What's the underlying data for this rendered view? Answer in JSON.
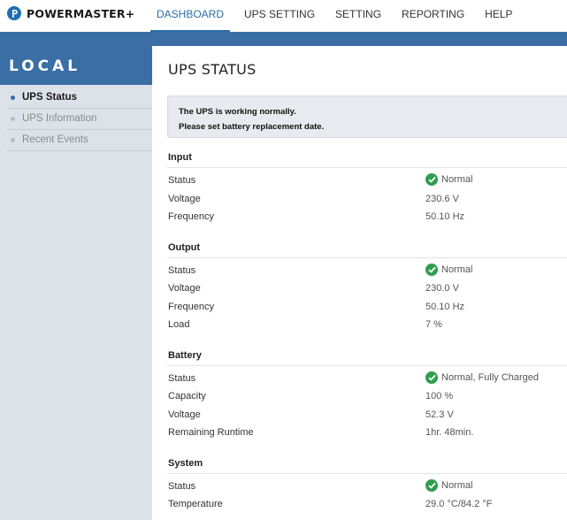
{
  "brand": {
    "name": "POWERMASTER",
    "plus": "+"
  },
  "nav": [
    {
      "label": "DASHBOARD"
    },
    {
      "label": "UPS SETTING"
    },
    {
      "label": "SETTING"
    },
    {
      "label": "REPORTING"
    },
    {
      "label": "HELP"
    }
  ],
  "sidebar": {
    "title": "LOCAL",
    "items": [
      {
        "label": "UPS Status"
      },
      {
        "label": "UPS Information"
      },
      {
        "label": "Recent Events"
      }
    ]
  },
  "main": {
    "title": "UPS STATUS",
    "notice": {
      "line1": "The UPS is working normally.",
      "line2": "Please set battery replacement date."
    },
    "sections": {
      "input": {
        "title": "Input",
        "rows": [
          {
            "label": "Status",
            "value": "Normal"
          },
          {
            "label": "Voltage",
            "value": "230.6 V"
          },
          {
            "label": "Frequency",
            "value": "50.10 Hz"
          }
        ]
      },
      "output": {
        "title": "Output",
        "rows": [
          {
            "label": "Status",
            "value": "Normal"
          },
          {
            "label": "Voltage",
            "value": "230.0 V"
          },
          {
            "label": "Frequency",
            "value": "50.10 Hz"
          },
          {
            "label": "Load",
            "value": "7 %"
          }
        ]
      },
      "battery": {
        "title": "Battery",
        "rows": [
          {
            "label": "Status",
            "value": "Normal, Fully Charged"
          },
          {
            "label": "Capacity",
            "value": "100 %"
          },
          {
            "label": "Voltage",
            "value": "52.3 V"
          },
          {
            "label": "Remaining Runtime",
            "value": "1hr. 48min."
          }
        ]
      },
      "system": {
        "title": "System",
        "rows": [
          {
            "label": "Status",
            "value": "Normal"
          },
          {
            "label": "Temperature",
            "value": "29.0 °C/84.2 °F"
          }
        ]
      }
    }
  },
  "colors": {
    "accent": "#3a6ea5",
    "nav_active": "#2d6da6",
    "status_ok": "#2e9e4f",
    "sidebar_bg": "#dde2e9"
  },
  "icons": {
    "status_ok": "check-circle-icon",
    "logo": "powermaster-logo-icon"
  }
}
